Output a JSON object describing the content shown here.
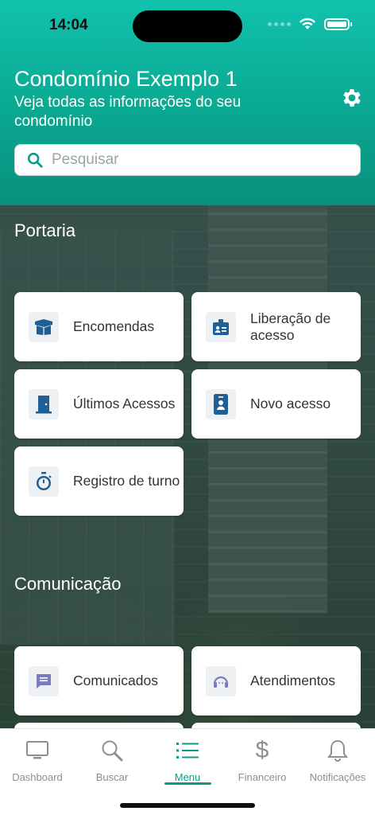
{
  "status": {
    "time": "14:04"
  },
  "header": {
    "title": "Condomínio Exemplo 1",
    "subtitle": "Veja todas as informações do seu condomínio"
  },
  "search": {
    "placeholder": "Pesquisar"
  },
  "sections": {
    "portaria": {
      "title": "Portaria",
      "items": [
        {
          "label": "Encomendas",
          "icon": "package-icon"
        },
        {
          "label": "Liberação de acesso",
          "icon": "id-badge-icon"
        },
        {
          "label": "Últimos Acessos",
          "icon": "door-icon"
        },
        {
          "label": "Novo acesso",
          "icon": "contact-card-icon"
        },
        {
          "label": "Registro de turno",
          "icon": "stopwatch-icon"
        }
      ]
    },
    "comunicacao": {
      "title": "Comunicação",
      "items": [
        {
          "label": "Comunicados",
          "icon": "message-icon"
        },
        {
          "label": "Atendimentos",
          "icon": "headset-icon"
        }
      ]
    }
  },
  "tabbar": {
    "items": [
      {
        "label": "Dashboard",
        "icon": "monitor-icon"
      },
      {
        "label": "Buscar",
        "icon": "search-icon"
      },
      {
        "label": "Menu",
        "icon": "list-icon",
        "active": true
      },
      {
        "label": "Financeiro",
        "icon": "dollar-icon"
      },
      {
        "label": "Notificações",
        "icon": "bell-icon"
      }
    ]
  },
  "colors": {
    "accent": "#0a9c8b",
    "header_top": "#12c2ad",
    "icon_blue": "#1f5f94",
    "icon_purple": "#7b7bbf"
  }
}
